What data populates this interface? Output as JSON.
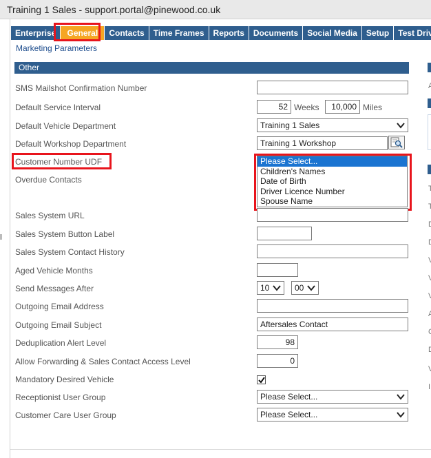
{
  "window": {
    "title": "Training 1 Sales - support.portal@pinewood.co.uk"
  },
  "tabs": [
    "Enterprise",
    "General",
    "Contacts",
    "Time Frames",
    "Reports",
    "Documents",
    "Social Media",
    "Setup",
    "Test Drive"
  ],
  "active_tab": "General",
  "subtab": "Marketing Parameters",
  "section": {
    "title": "Other"
  },
  "fields": {
    "sms_mailshot": {
      "label": "SMS Mailshot Confirmation Number",
      "value": ""
    },
    "service_interval": {
      "label": "Default Service Interval",
      "weeks": "52",
      "weeks_unit": "Weeks",
      "miles": "10,000",
      "miles_unit": "Miles"
    },
    "vehicle_department": {
      "label": "Default Vehicle Department",
      "value": "Training 1 Sales"
    },
    "workshop_department": {
      "label": "Default Workshop Department",
      "value": "Training 1 Workshop"
    },
    "customer_number_udf": {
      "label": "Customer Number UDF",
      "options": [
        "Please Select...",
        "Children's Names",
        "Date of Birth",
        "Driver Licence Number",
        "Spouse Name"
      ],
      "selected": "Please Select..."
    },
    "overdue_contacts": {
      "label": "Overdue Contacts"
    },
    "sales_system_url": {
      "label": "Sales System URL",
      "value": ""
    },
    "sales_system_button_label": {
      "label": "Sales System Button Label",
      "value": ""
    },
    "sales_system_contact_history": {
      "label": "Sales System Contact History",
      "value": ""
    },
    "aged_vehicle_months": {
      "label": "Aged Vehicle Months",
      "value": ""
    },
    "send_messages_after": {
      "label": "Send Messages After",
      "hour": "10",
      "minute": "00"
    },
    "outgoing_email_address": {
      "label": "Outgoing Email Address",
      "value": ""
    },
    "outgoing_email_subject": {
      "label": "Outgoing Email Subject",
      "value": "Aftersales Contact"
    },
    "deduplication_alert_level": {
      "label": "Deduplication Alert Level",
      "value": "98"
    },
    "allow_forwarding": {
      "label": "Allow Forwarding & Sales Contact Access Level",
      "value": "0"
    },
    "mandatory_desired_vehicle": {
      "label": "Mandatory Desired Vehicle",
      "checked": true
    },
    "receptionist_user_group": {
      "label": "Receptionist User Group",
      "value": "Please Select..."
    },
    "customer_care_user_group": {
      "label": "Customer Care User Group",
      "value": "Please Select..."
    }
  },
  "right_panel_fragments": [
    "A",
    "T",
    "T",
    "D",
    "D",
    "V",
    "V",
    "V",
    "A",
    "C",
    "D",
    "V",
    "I"
  ],
  "colors": {
    "tab_bg": "#2f5e8e",
    "active_tab": "#f5a623",
    "highlight": "#e8141c",
    "list_selected": "#1a74d1"
  },
  "icons": {
    "lookup": "magnifier-document-icon",
    "dropdown": "chevron-down-icon",
    "check": "checkmark-icon"
  }
}
